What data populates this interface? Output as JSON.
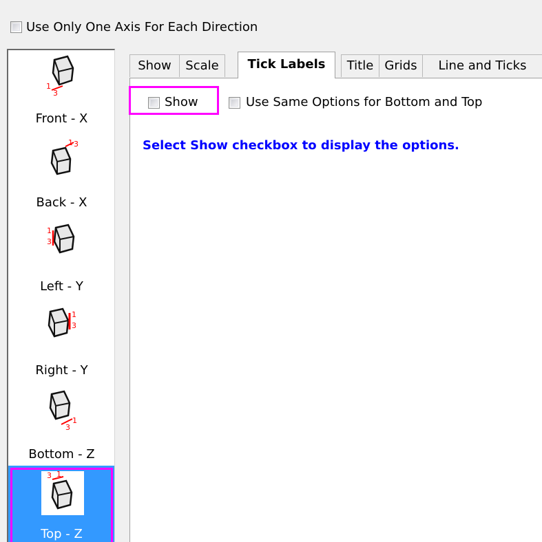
{
  "top_option": {
    "label": "Use Only One Axis For Each Direction",
    "checked": false
  },
  "axis_list": [
    {
      "label": "Front - X",
      "icon": "axis-front-x-icon",
      "selected": false
    },
    {
      "label": "Back - X",
      "icon": "axis-back-x-icon",
      "selected": false
    },
    {
      "label": "Left - Y",
      "icon": "axis-left-y-icon",
      "selected": false
    },
    {
      "label": "Right - Y",
      "icon": "axis-right-y-icon",
      "selected": false
    },
    {
      "label": "Bottom - Z",
      "icon": "axis-bottom-z-icon",
      "selected": false
    },
    {
      "label": "Top - Z",
      "icon": "axis-top-z-icon",
      "selected": true
    }
  ],
  "tabs": [
    {
      "label": "Show",
      "active": false
    },
    {
      "label": "Scale",
      "active": false
    },
    {
      "label": "Tick Labels",
      "active": true
    },
    {
      "label": "Title",
      "active": false
    },
    {
      "label": "Grids",
      "active": false
    },
    {
      "label": "Line and Ticks",
      "active": false
    }
  ],
  "panel": {
    "show_checkbox": {
      "label": "Show",
      "checked": false
    },
    "same_options_checkbox": {
      "label": "Use Same Options for Bottom and Top",
      "checked": false
    },
    "hint": "Select Show checkbox to display the options."
  },
  "icon_digits": {
    "one": "1",
    "three": "3"
  },
  "colors": {
    "selection": "#3399ff",
    "highlight": "#ff00ff",
    "hint": "#0000ff",
    "axis_marker": "#ff0000"
  }
}
